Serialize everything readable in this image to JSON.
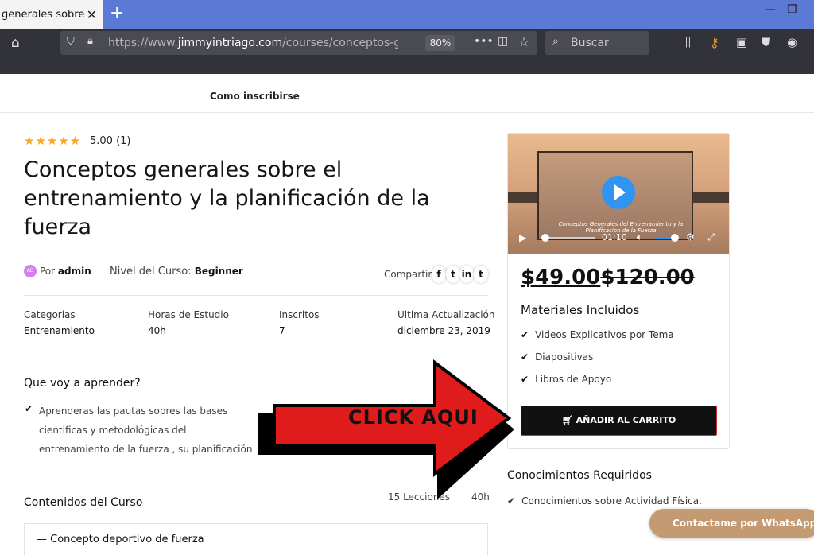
{
  "browser": {
    "tab_title": "generales sobre el e",
    "url_prefix": "https://www.",
    "url_domain": "jimmyintriago.com",
    "url_path": "/courses/conceptos-generales",
    "zoom": "80%",
    "search_placeholder": "Buscar",
    "accent_color": "#5b7ad6"
  },
  "nav": {
    "link": "Como inscribirse"
  },
  "course": {
    "stars": "★★★★★",
    "rating": "5.00 (1)",
    "title": "Conceptos generales sobre el entrenamiento y la planificación de la fuerza",
    "avatar_initials": "AD",
    "by_label": "Por",
    "author": "admin",
    "level_label": "Nivel del Curso:",
    "level": "Beginner",
    "share_label": "Compartir:",
    "share_icons": [
      "f",
      "t",
      "in",
      "t"
    ]
  },
  "meta": {
    "categories_label": "Categorias",
    "categories_value": "Entrenamiento",
    "hours_label": "Horas de Estudio",
    "hours_value": "40h",
    "enrolled_label": "Inscritos",
    "enrolled_value": "7",
    "updated_label": "Ultima Actualización",
    "updated_value": "diciembre 23, 2019"
  },
  "learn": {
    "heading": "Que voy a aprender?",
    "item": "Aprenderas las pautas sobres las bases cientificas y metodológicas del entrenamiento de la fuerza , su planificación"
  },
  "contents": {
    "heading": "Contenidos del Curso",
    "lessons": "15 Lecciones",
    "hours": "40h",
    "first_item": "Concepto deportivo de fuerza"
  },
  "video": {
    "caption": "Conceptos Generales del Entrenamiento y la Planificacion de la Fuerza",
    "time": "01:10"
  },
  "pricing": {
    "price": "$49.00",
    "old_price": "$120.00",
    "materials_heading": "Materiales Incluidos",
    "materials": [
      "Videos Explicativos por Tema",
      "Diapositivas",
      "Libros de Apoyo"
    ],
    "cart_button": "AÑADIR AL CARRITO"
  },
  "requirements": {
    "heading": "Conocimientos Requiridos",
    "item": "Conocimientos sobre Actividad Física."
  },
  "overlay": {
    "arrow_text": "CLICK AQUI",
    "arrow_color": "#e01b1b"
  },
  "whatsapp": {
    "label": "Contactame por WhatsApp",
    "color": "#c49a73"
  }
}
